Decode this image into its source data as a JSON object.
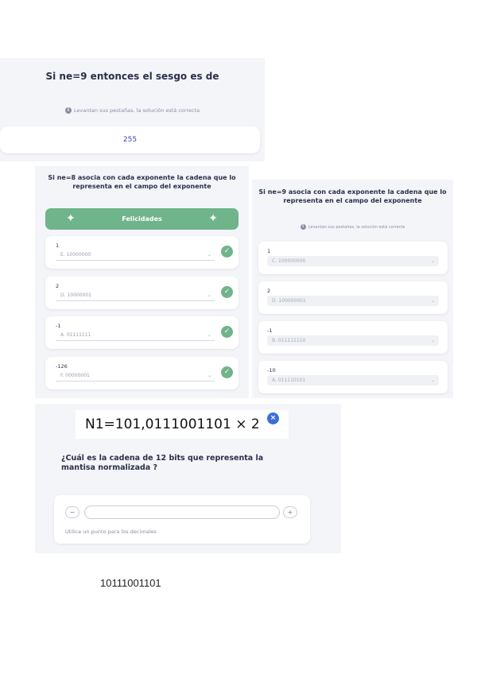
{
  "panel1": {
    "title": "Si ne=9 entonces el sesgo es de",
    "hint": "Levantan sus pestañas, la solución está correcta",
    "answer": "255"
  },
  "panel2": {
    "title": "Si ne=8 asocia con cada exponente la cadena que lo representa en el campo del exponente",
    "banner": "Felicidades",
    "items": [
      {
        "label": "1",
        "value": "E. 10000000"
      },
      {
        "label": "2",
        "value": "D. 10000001"
      },
      {
        "label": "-1",
        "value": "A. 01111111"
      },
      {
        "label": "-126",
        "value": "F. 00000001"
      }
    ]
  },
  "panel3": {
    "title": "Si ne=9 asocia con cada exponente la cadena que lo representa en el campo del exponente",
    "hint": "Levantan sus pestañas, la solución está correcta",
    "items": [
      {
        "label": "1",
        "value": "C. 100000000"
      },
      {
        "label": "2",
        "value": "D. 100000001"
      },
      {
        "label": "-1",
        "value": "B. 011111110"
      },
      {
        "label": "-10",
        "value": "A. 011110101"
      }
    ]
  },
  "panel4": {
    "formula": "N1=101,0111001101 × 2",
    "close_badge": "×",
    "question": "¿Cuál es la cadena de 12 bits que representa la mantisa normalizada ?",
    "minus_label": "−",
    "plus_label": "+",
    "input_value": "",
    "note": "Utilice un punto para los decimales"
  },
  "handwritten_answer": "10111001101",
  "colors": {
    "panel_bg": "#f4f5f9",
    "success_green": "#6fb48a",
    "accent_blue": "#3a6fd8",
    "title_text": "#2b2f4a"
  }
}
